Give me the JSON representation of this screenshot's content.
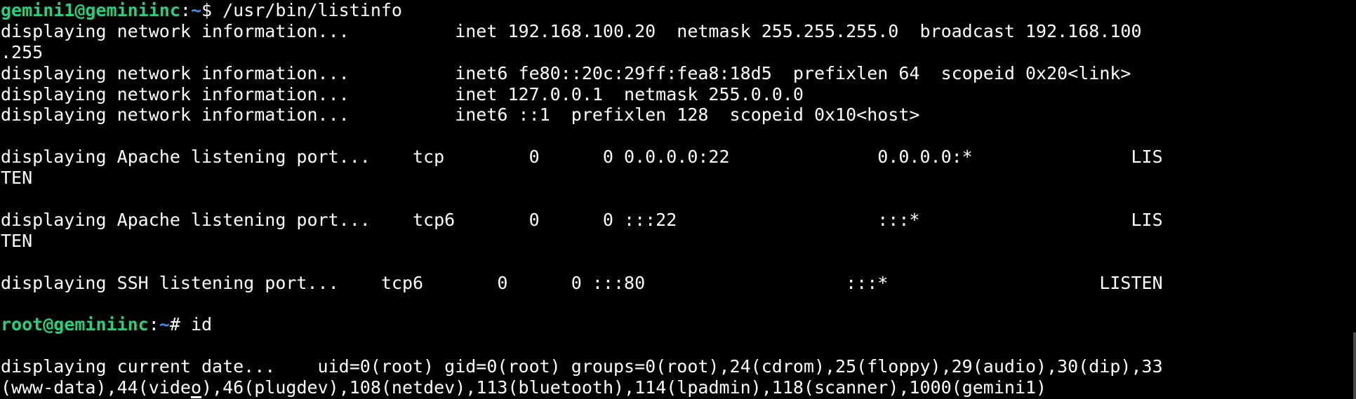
{
  "prompt1": {
    "user_host": "gemini1@geminiinc",
    "sep": ":",
    "path": "~",
    "symbol": "$ ",
    "command": "/usr/bin/listinfo"
  },
  "output": [
    "displaying network information...          inet 192.168.100.20  netmask 255.255.255.0  broadcast 192.168.100",
    ".255",
    "displaying network information...          inet6 fe80::20c:29ff:fea8:18d5  prefixlen 64  scopeid 0x20<link>",
    "displaying network information...          inet 127.0.0.1  netmask 255.0.0.0",
    "displaying network information...          inet6 ::1  prefixlen 128  scopeid 0x10<host>",
    "",
    "displaying Apache listening port...    tcp        0      0 0.0.0.0:22              0.0.0.0:*               LIS",
    "TEN",
    "",
    "displaying Apache listening port...    tcp6       0      0 :::22                   :::*                    LIS",
    "TEN",
    "",
    "displaying SSH listening port...    tcp6       0      0 :::80                   :::*                    LISTEN",
    ""
  ],
  "prompt2": {
    "user_host": "root@geminiinc",
    "sep": ":",
    "path": "~",
    "symbol": "# ",
    "command": "id"
  },
  "output2": [
    "",
    "displaying current date...    uid=0(root) gid=0(root) groups=0(root),24(cdrom),25(floppy),29(audio),30(dip),33"
  ],
  "last_line": {
    "before_cursor": "(www-data),44(vide",
    "cursor_char": "o",
    "after_cursor": "),46(plugdev),108(netdev),113(bluetooth),114(lpadmin),118(scanner),1000(gemini1)"
  }
}
